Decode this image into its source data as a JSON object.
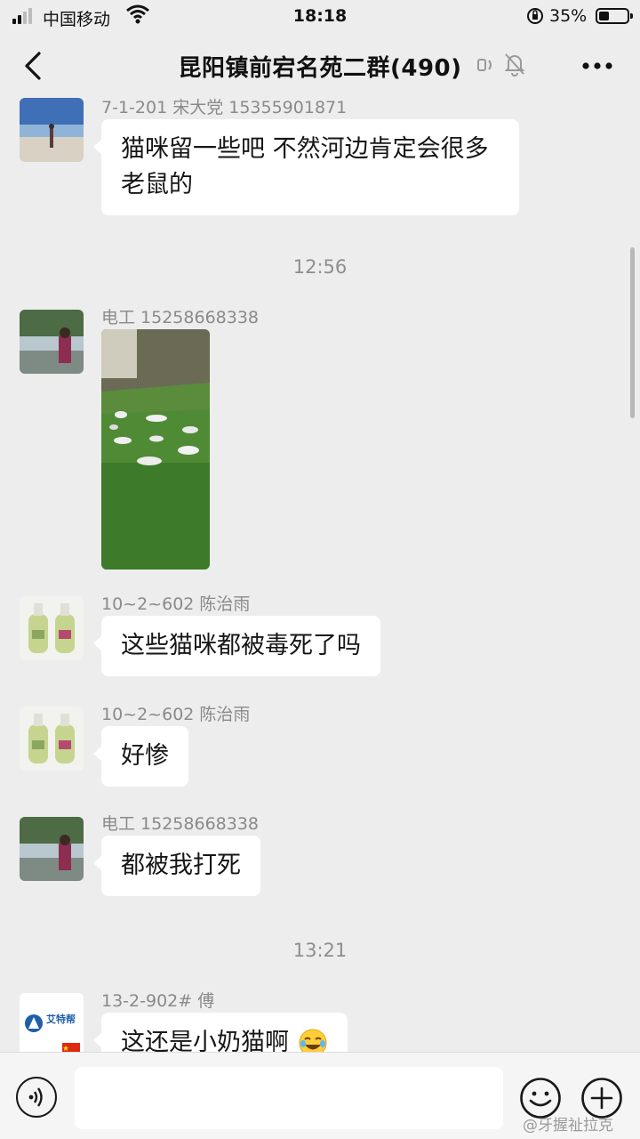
{
  "status_bar": {
    "carrier": "中国移动",
    "time": "18:18",
    "battery": "35%",
    "battery_level": 0.35
  },
  "header": {
    "title": "昆阳镇前宕名苑二群(490)"
  },
  "messages": [
    {
      "sender": "7-1-201 宋大党 15355901871",
      "text": "猫咪留一些吧 不然河边肯定会很多老鼠的"
    },
    {
      "sender": "电工 15258668338"
    },
    {
      "sender": "10~2~602 陈治雨",
      "text": "这些猫咪都被毒死了吗"
    },
    {
      "sender": "10~2~602 陈治雨",
      "text": "好惨"
    },
    {
      "sender": "电工 15258668338",
      "text": "都被我打死"
    },
    {
      "sender": "13-2-902# 傅",
      "text": "这还是小奶猫啊"
    }
  ],
  "times": [
    "12:56",
    "13:21"
  ],
  "avatars": {
    "company_logo_text": "艾特帮"
  },
  "watermark": "@牙握祉拉克",
  "colors": {
    "background": "#ededed",
    "bubble": "#ffffff",
    "input_bar": "#f5f5f5"
  }
}
